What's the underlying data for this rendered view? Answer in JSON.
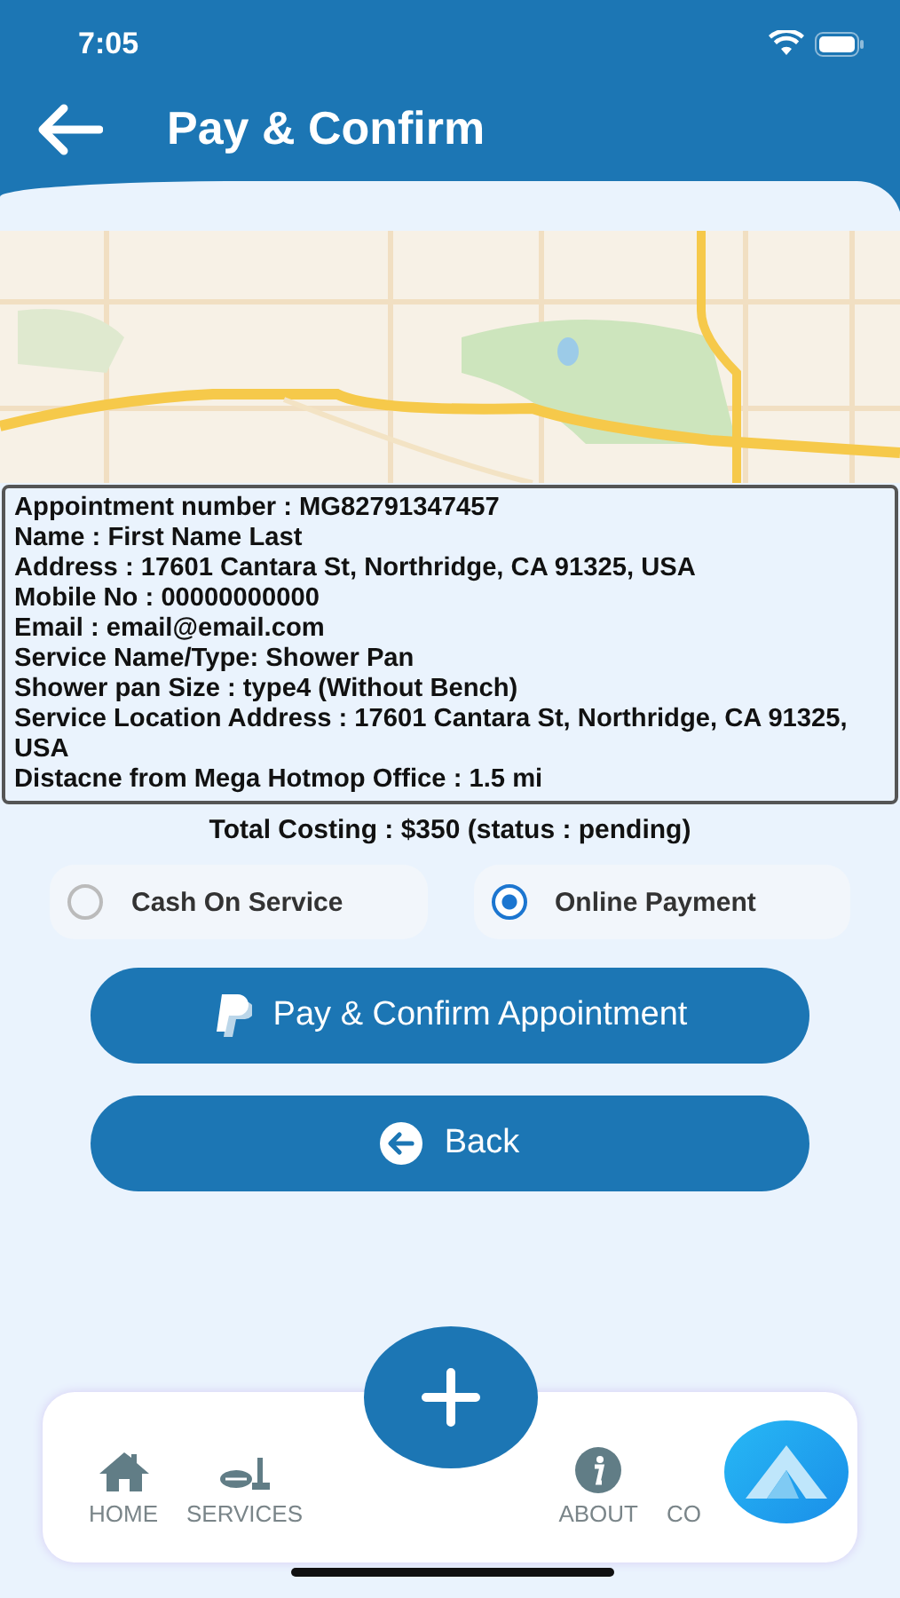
{
  "status_bar": {
    "time": "7:05"
  },
  "header": {
    "title": "Pay & Confirm"
  },
  "details": [
    "Appointment number : MG82791347457",
    "Name : First Name Last",
    "Address : 17601 Cantara St, Northridge, CA 91325, USA",
    "Mobile No : 00000000000",
    "Email : email@email.com",
    "Service Name/Type: Shower Pan",
    "Shower pan Size : type4 (Without Bench)",
    "Service Location Address : 17601 Cantara St, Northridge, CA 91325, USA",
    "Distacne from Mega Hotmop Office : 1.5 mi"
  ],
  "total": "Total Costing :  $350 (status : pending)",
  "payment_options": [
    {
      "label": "Cash On Service",
      "selected": false
    },
    {
      "label": "Online Payment",
      "selected": true
    }
  ],
  "buttons": [
    {
      "kind": "paypal",
      "label": "Pay & Confirm Appointment"
    },
    {
      "kind": "back",
      "label": "Back"
    }
  ],
  "nav": [
    {
      "kind": "home",
      "label": "HOME"
    },
    {
      "kind": "services",
      "label": "SERVICES"
    },
    {
      "kind": "about",
      "label": "ABOUT"
    },
    {
      "kind": "contact",
      "label": "CO"
    }
  ]
}
